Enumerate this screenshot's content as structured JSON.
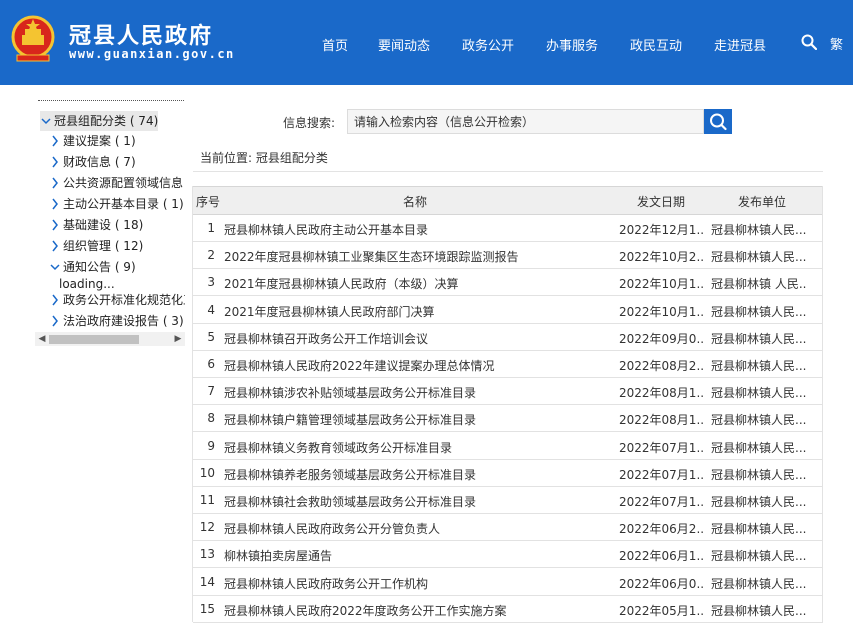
{
  "header": {
    "title": "冠县人民政府",
    "url": "www.guanxian.gov.cn",
    "nav": [
      "首页",
      "要闻动态",
      "政务公开",
      "办事服务",
      "政民互动",
      "走进冠县"
    ],
    "traditional": "繁",
    "bg_color": "#1a69c9"
  },
  "tree": {
    "items": [
      {
        "label": "冠县组配分类 ( 74)",
        "icon": "chevron-down-icon"
      },
      {
        "label": "建议提案 ( 1)",
        "icon": "chevron-right-icon"
      },
      {
        "label": "财政信息 ( 7)",
        "icon": "chevron-right-icon"
      },
      {
        "label": "公共资源配置领域信息 (",
        "icon": "chevron-right-icon"
      },
      {
        "label": "主动公开基本目录 ( 1)",
        "icon": "chevron-right-icon"
      },
      {
        "label": "基础建设 ( 18)",
        "icon": "chevron-right-icon"
      },
      {
        "label": "组织管理 ( 12)",
        "icon": "chevron-right-icon"
      },
      {
        "label": "通知公告 ( 9)",
        "icon": "chevron-down-icon"
      },
      {
        "label": "loading...",
        "icon": ""
      },
      {
        "label": "政务公开标准化规范化工",
        "icon": "chevron-right-icon"
      },
      {
        "label": "法治政府建设报告 ( 3)",
        "icon": "chevron-right-icon"
      }
    ]
  },
  "search": {
    "label": "信息搜索:",
    "placeholder": "请输入检索内容（信息公开检索）"
  },
  "breadcrumb": "当前位置: 冠县组配分类",
  "table": {
    "headers": [
      "序号",
      "名称",
      "发文日期",
      "发布单位"
    ],
    "rows": [
      {
        "no": "1",
        "name": "冠县柳林镇人民政府主动公开基本目录",
        "date": "2022年12月1...",
        "unit": "冠县柳林镇人民..."
      },
      {
        "no": "2",
        "name": "2022年度冠县柳林镇工业聚集区生态环境跟踪监测报告",
        "date": "2022年10月2...",
        "unit": "冠县柳林镇人民..."
      },
      {
        "no": "3",
        "name": "2021年度冠县柳林镇人民政府（本级）决算",
        "date": "2022年10月1...",
        "unit": "冠县柳林镇 人民..."
      },
      {
        "no": "4",
        "name": "2021年度冠县柳林镇人民政府部门决算",
        "date": "2022年10月1...",
        "unit": "冠县柳林镇人民..."
      },
      {
        "no": "5",
        "name": "冠县柳林镇召开政务公开工作培训会议",
        "date": "2022年09月0...",
        "unit": "冠县柳林镇人民..."
      },
      {
        "no": "6",
        "name": "冠县柳林镇人民政府2022年建议提案办理总体情况",
        "date": "2022年08月2...",
        "unit": "冠县柳林镇人民..."
      },
      {
        "no": "7",
        "name": "冠县柳林镇涉农补贴领域基层政务公开标准目录",
        "date": "2022年08月1...",
        "unit": "冠县柳林镇人民..."
      },
      {
        "no": "8",
        "name": "冠县柳林镇户籍管理领域基层政务公开标准目录",
        "date": "2022年08月1...",
        "unit": "冠县柳林镇人民..."
      },
      {
        "no": "9",
        "name": "冠县柳林镇义务教育领域政务公开标准目录",
        "date": "2022年07月1...",
        "unit": "冠县柳林镇人民..."
      },
      {
        "no": "10",
        "name": "冠县柳林镇养老服务领域基层政务公开标准目录",
        "date": "2022年07月1...",
        "unit": "冠县柳林镇人民..."
      },
      {
        "no": "11",
        "name": "冠县柳林镇社会救助领域基层政务公开标准目录",
        "date": "2022年07月1...",
        "unit": "冠县柳林镇人民..."
      },
      {
        "no": "12",
        "name": "冠县柳林镇人民政府政务公开分管负责人",
        "date": "2022年06月2...",
        "unit": "冠县柳林镇人民..."
      },
      {
        "no": "13",
        "name": "柳林镇拍卖房屋通告",
        "date": "2022年06月1...",
        "unit": "冠县柳林镇人民..."
      },
      {
        "no": "14",
        "name": "冠县柳林镇人民政府政务公开工作机构",
        "date": "2022年06月0...",
        "unit": "冠县柳林镇人民..."
      },
      {
        "no": "15",
        "name": "冠县柳林镇人民政府2022年度政务公开工作实施方案",
        "date": "2022年05月1...",
        "unit": "冠县柳林镇人民..."
      }
    ]
  }
}
